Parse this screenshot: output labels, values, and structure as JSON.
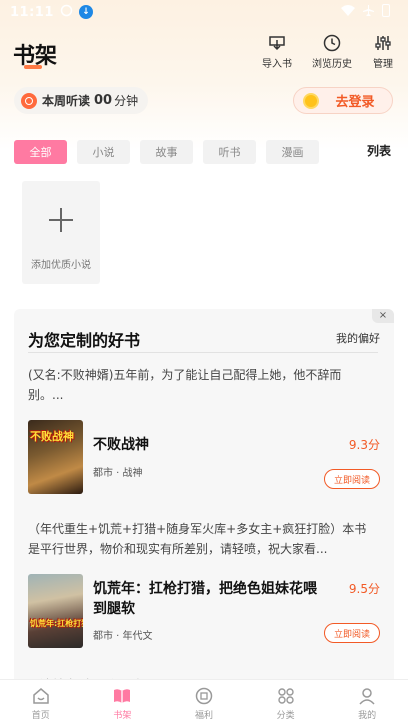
{
  "status_bar": {
    "time": "11:11"
  },
  "header": {
    "title": "书架",
    "import_label": "导入书",
    "history_label": "浏览历史",
    "manage_label": "管理"
  },
  "listen": {
    "label": "本周听读",
    "value": "00",
    "unit": "分钟"
  },
  "login": {
    "label": "去登录"
  },
  "filters": {
    "tabs": [
      "全部",
      "小说",
      "故事",
      "听书",
      "漫画"
    ],
    "active": "全部",
    "view_toggle": "列表"
  },
  "add_book": {
    "label": "添加优质小说"
  },
  "recommendation": {
    "title": "为您定制的好书",
    "pref_label": "我的偏好",
    "close": "×",
    "books": [
      {
        "desc": "(又名:不败神婿)五年前，为了能让自己配得上她，他不辞而别。...",
        "cover_text": "不败战神",
        "name": "不败战神",
        "tags": "都市 · 战神",
        "score": "9.3分",
        "action": "立即阅读"
      },
      {
        "desc": "（年代重生+饥荒+打猎+随身军火库+多女主+疯狂打脸）本书是平行世界，物价和现实有所差别，请轻喷，祝大家看...",
        "cover_text": "饥荒年:扛枪打猎",
        "name": "饥荒年：扛枪打猎，把绝色姐妹花喂到腿软",
        "tags": "都市 · 年代文",
        "score": "9.5分",
        "action": "立即阅读"
      }
    ],
    "peek_text": "【渣前   打脸   五鼠上床】"
  },
  "bottom_nav": {
    "items": [
      "首页",
      "书架",
      "福利",
      "分类",
      "我的"
    ],
    "active": "书架"
  },
  "colors": {
    "accent": "#ff7aa2",
    "orange": "#f25a26"
  }
}
